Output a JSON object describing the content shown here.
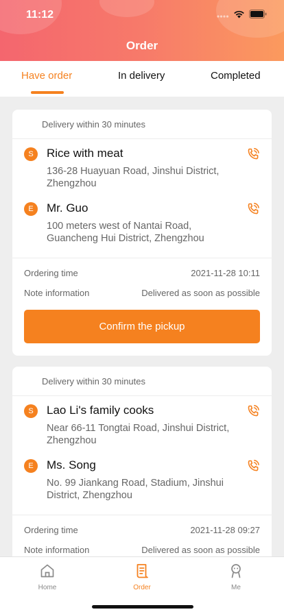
{
  "status_bar": {
    "time": "11:12"
  },
  "header": {
    "title": "Order"
  },
  "tabs": [
    {
      "label": "Have order",
      "active": true
    },
    {
      "label": "In delivery",
      "active": false
    },
    {
      "label": "Completed",
      "active": false
    }
  ],
  "orders": [
    {
      "delivery_note": "Delivery within 30 minutes",
      "pickup": {
        "badge": "S",
        "name": "Rice with meat",
        "address": "136-28 Huayuan Road, Jinshui District, Zhengzhou"
      },
      "dropoff": {
        "badge": "E",
        "name": "Mr. Guo",
        "address": "100 meters west of Nantai Road, Guancheng Hui District, Zhengzhou"
      },
      "ordering_time_label": "Ordering time",
      "ordering_time": "2021-11-28 10:11",
      "note_label": "Note information",
      "note": "Delivered as soon as possible",
      "button_label": "Confirm the pickup"
    },
    {
      "delivery_note": "Delivery within 30 minutes",
      "pickup": {
        "badge": "S",
        "name": "Lao Li's family cooks",
        "address": "Near 66-11 Tongtai Road, Jinshui District, Zhengzhou"
      },
      "dropoff": {
        "badge": "E",
        "name": "Ms. Song",
        "address": "No. 99 Jiankang Road, Stadium, Jinshui District, Zhengzhou"
      },
      "ordering_time_label": "Ordering time",
      "ordering_time": "2021-11-28 09:27",
      "note_label": "Note information",
      "note": "Delivered as soon as possible"
    }
  ],
  "bottom_nav": [
    {
      "label": "Home",
      "icon": "home-icon",
      "active": false
    },
    {
      "label": "Order",
      "icon": "order-icon",
      "active": true
    },
    {
      "label": "Me",
      "icon": "person-icon",
      "active": false
    }
  ],
  "colors": {
    "accent": "#f5811f",
    "header_start": "#f4666e",
    "header_end": "#fb9a5e"
  }
}
